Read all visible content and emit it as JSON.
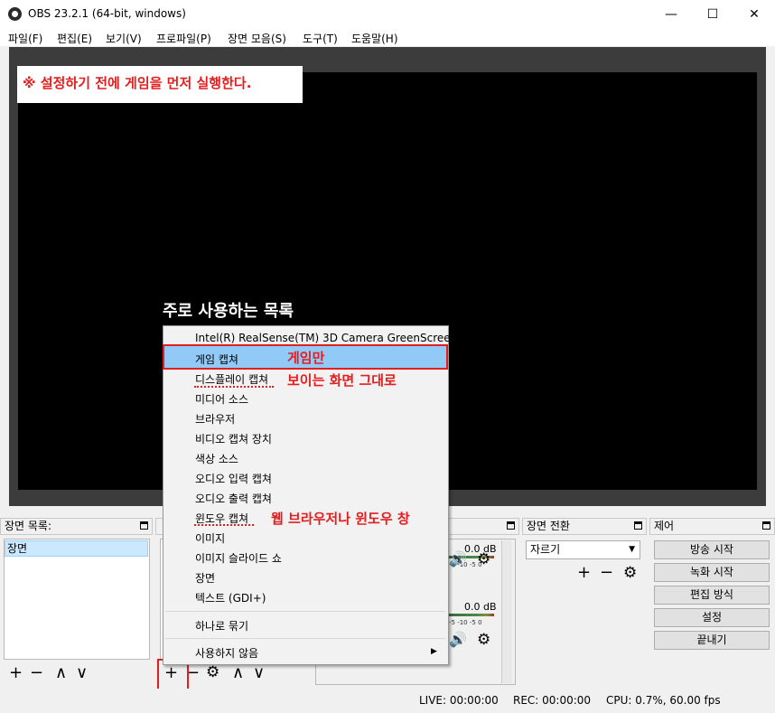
{
  "window": {
    "title": "OBS 23.2.1 (64-bit, windows)",
    "minimize": "—",
    "maximize": "☐",
    "close": "✕"
  },
  "menu": [
    "파일(F)",
    "편집(E)",
    "보기(V)",
    "프로파일(P)",
    "장면 모음(S)",
    "도구(T)",
    "도움말(H)"
  ],
  "preview": {
    "note": "※ 설정하기 전에 게임을 먼저 실행한다.",
    "common_label": "주로 사용하는 목록"
  },
  "docks": {
    "scenes_title": "장면 목록:",
    "scene_item": "장면",
    "transitions_title": "장면 전환",
    "transition_value": "자르기",
    "controls_title": "제어"
  },
  "mixer": {
    "ch1_db": "0.0 dB",
    "ch2_db": "0.0 dB",
    "ticks": "-5 -10 -5 0"
  },
  "controls": [
    "방송 시작",
    "녹화 시작",
    "편집 방식",
    "설정",
    "끝내기"
  ],
  "icons": {
    "add": "+",
    "remove": "−",
    "up": "∧",
    "down": "∨",
    "gear": "⚙",
    "volume": "🔊"
  },
  "context_menu": {
    "items": [
      "Intel(R) RealSense(TM) 3D Camera GreenScreen",
      "게임 캡쳐",
      "디스플레이 캡쳐",
      "미디어 소스",
      "브라우저",
      "비디오 캡쳐 장치",
      "색상 소스",
      "오디오 입력 캡쳐",
      "오디오 출력 캡쳐",
      "윈도우 캡쳐",
      "이미지",
      "이미지 슬라이드 쇼",
      "장면",
      "텍스트 (GDI+)"
    ],
    "group": "하나로 묶기",
    "deprecated": "사용하지 않음"
  },
  "annotations": {
    "game_only": "게임만",
    "display_as_is": "보이는 화면 그대로",
    "web_or_window": "웹 브라우저나 윈도우 창"
  },
  "status": {
    "live": "LIVE: 00:00:00",
    "rec": "REC: 00:00:00",
    "cpu": "CPU: 0.7%, 60.00 fps"
  }
}
